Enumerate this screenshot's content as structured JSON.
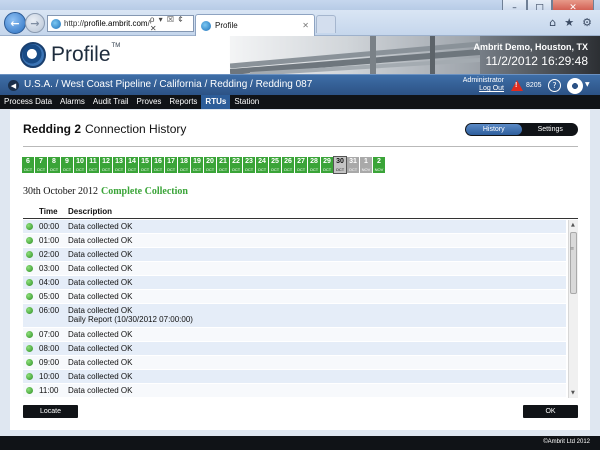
{
  "browser": {
    "url_prefix": "http://",
    "url_host": "profile.ambrit.com",
    "url_suffix": "/",
    "url_controls": "ρ ▾ ☒ ¢ ✕",
    "tab_title": "Profile",
    "tab_close": "✕",
    "win_minimize": "–",
    "win_maximize": "□",
    "win_close": "✕",
    "back": "←",
    "forward": "→",
    "home": "⌂",
    "favorites": "★",
    "tools": "⚙"
  },
  "app": {
    "logo_text": "Profile",
    "logo_tm": "TM",
    "company": "Ambrit Demo, Houston, TX",
    "datetime": "11/2/2012  16:29:48"
  },
  "breadcrumb": {
    "back": "◀",
    "path": "U.S.A. / West Coast Pipeline / California / Redding / Redding 087"
  },
  "user": {
    "name": "Administrator",
    "logout": "Log Out",
    "alarm_count": "8205",
    "alarm_mark": "!",
    "help": "?",
    "gear_caret": "▼"
  },
  "menu": [
    "Process Data",
    "Alarms",
    "Audit Trail",
    "Proves",
    "Reports",
    "RTUs",
    "Station"
  ],
  "menu_active": "RTUs",
  "page": {
    "device": "Redding 2",
    "title": "Connection History",
    "seg_history": "History",
    "seg_settings": "Settings"
  },
  "dates": [
    {
      "d": "6",
      "m": "OCT",
      "s": "ok"
    },
    {
      "d": "7",
      "m": "OCT",
      "s": "ok"
    },
    {
      "d": "8",
      "m": "OCT",
      "s": "ok"
    },
    {
      "d": "9",
      "m": "OCT",
      "s": "ok"
    },
    {
      "d": "10",
      "m": "OCT",
      "s": "ok"
    },
    {
      "d": "11",
      "m": "OCT",
      "s": "ok"
    },
    {
      "d": "12",
      "m": "OCT",
      "s": "ok"
    },
    {
      "d": "13",
      "m": "OCT",
      "s": "ok"
    },
    {
      "d": "14",
      "m": "OCT",
      "s": "ok"
    },
    {
      "d": "15",
      "m": "OCT",
      "s": "ok"
    },
    {
      "d": "16",
      "m": "OCT",
      "s": "ok"
    },
    {
      "d": "17",
      "m": "OCT",
      "s": "ok"
    },
    {
      "d": "18",
      "m": "OCT",
      "s": "ok"
    },
    {
      "d": "19",
      "m": "OCT",
      "s": "ok"
    },
    {
      "d": "20",
      "m": "OCT",
      "s": "ok"
    },
    {
      "d": "21",
      "m": "OCT",
      "s": "ok"
    },
    {
      "d": "22",
      "m": "OCT",
      "s": "ok"
    },
    {
      "d": "23",
      "m": "OCT",
      "s": "ok"
    },
    {
      "d": "24",
      "m": "OCT",
      "s": "ok"
    },
    {
      "d": "25",
      "m": "OCT",
      "s": "ok"
    },
    {
      "d": "26",
      "m": "OCT",
      "s": "ok"
    },
    {
      "d": "27",
      "m": "OCT",
      "s": "ok"
    },
    {
      "d": "28",
      "m": "OCT",
      "s": "ok"
    },
    {
      "d": "29",
      "m": "OCT",
      "s": "ok"
    },
    {
      "d": "30",
      "m": "OCT",
      "s": "selected"
    },
    {
      "d": "31",
      "m": "OCT",
      "s": "gray"
    },
    {
      "d": "1",
      "m": "NOV",
      "s": "gray"
    },
    {
      "d": "2",
      "m": "NOV",
      "s": "ok"
    }
  ],
  "collection": {
    "date": "30th October 2012",
    "status": "Complete Collection"
  },
  "table": {
    "col_time": "Time",
    "col_desc": "Description",
    "rows": [
      {
        "time": "00:00",
        "desc": "Data collected OK",
        "extra": ""
      },
      {
        "time": "01:00",
        "desc": "Data collected OK",
        "extra": ""
      },
      {
        "time": "02:00",
        "desc": "Data collected OK",
        "extra": ""
      },
      {
        "time": "03:00",
        "desc": "Data collected OK",
        "extra": ""
      },
      {
        "time": "04:00",
        "desc": "Data collected OK",
        "extra": ""
      },
      {
        "time": "05:00",
        "desc": "Data collected OK",
        "extra": ""
      },
      {
        "time": "06:00",
        "desc": "Data collected OK",
        "extra": "Daily Report (10/30/2012 07:00:00)"
      },
      {
        "time": "07:00",
        "desc": "Data collected OK",
        "extra": ""
      },
      {
        "time": "08:00",
        "desc": "Data collected OK",
        "extra": ""
      },
      {
        "time": "09:00",
        "desc": "Data collected OK",
        "extra": ""
      },
      {
        "time": "10:00",
        "desc": "Data collected OK",
        "extra": ""
      },
      {
        "time": "11:00",
        "desc": "Data collected OK",
        "extra": ""
      }
    ]
  },
  "scrollbar": {
    "up": "▲",
    "down": "▼",
    "grip": "≡"
  },
  "buttons": {
    "locate": "Locate",
    "ok": "OK"
  },
  "footer": "©Ambrit Ltd 2012",
  "colors": {
    "ok_green": "#3aa438",
    "accent_blue": "#2d5d99",
    "bar_dark": "#101317"
  }
}
